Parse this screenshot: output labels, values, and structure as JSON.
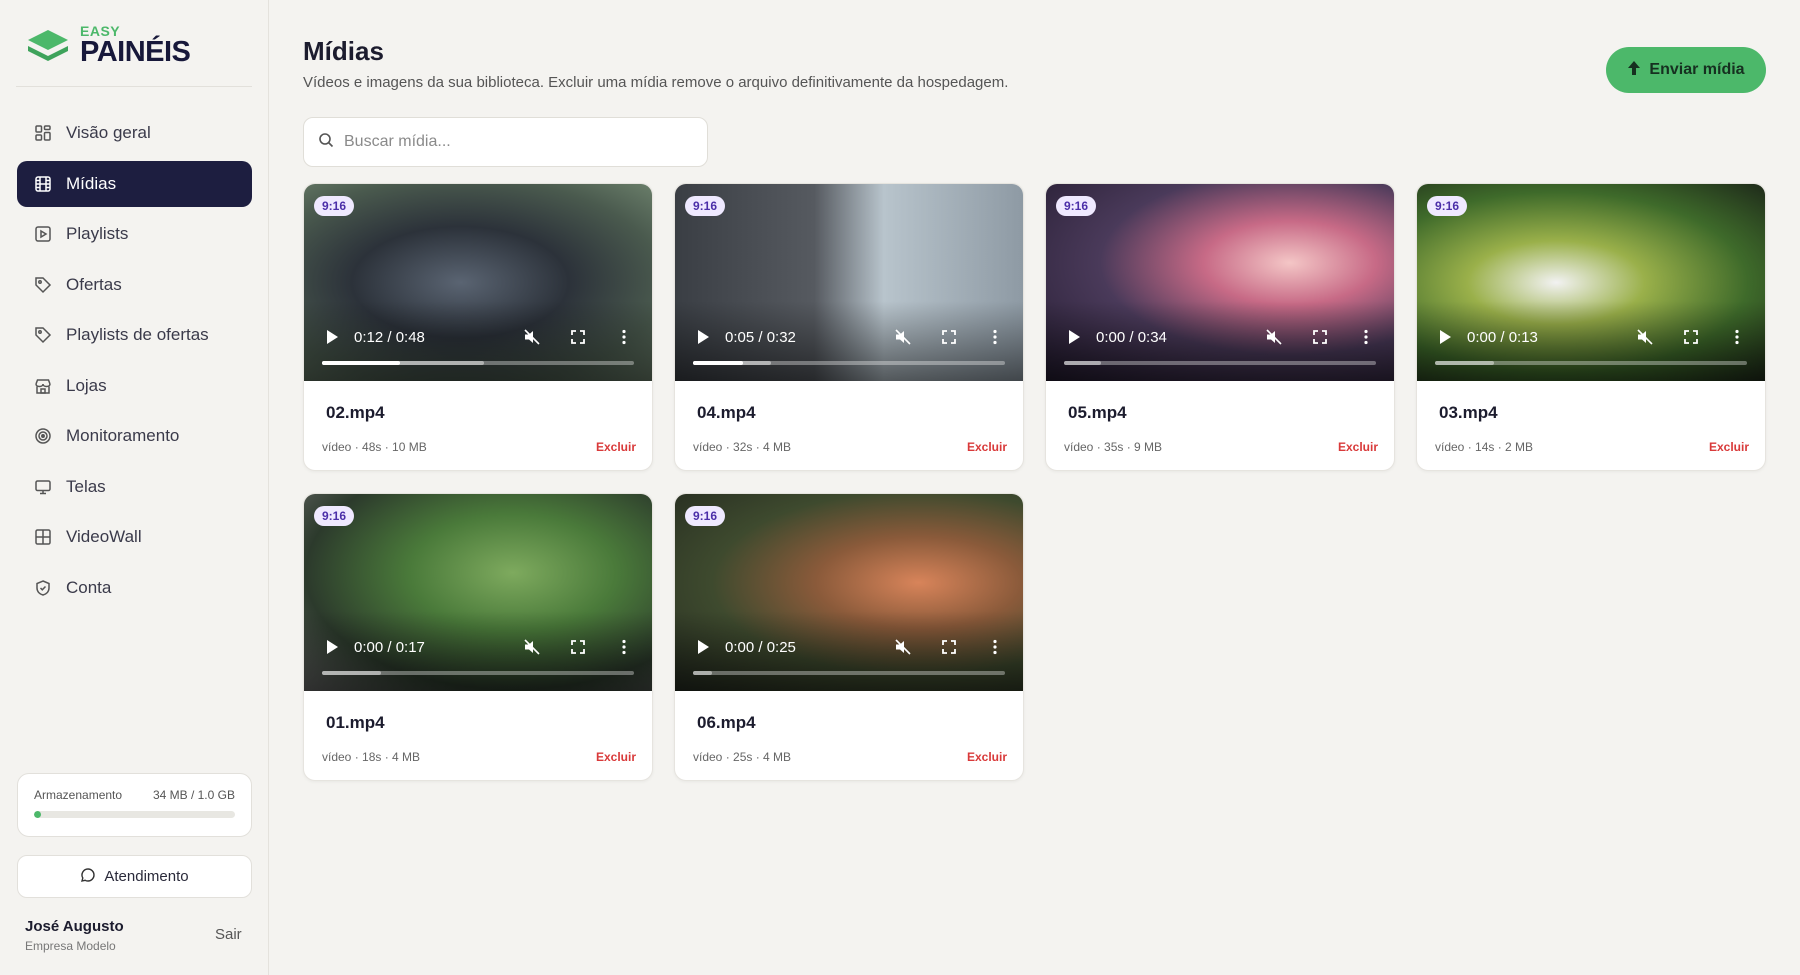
{
  "brand": {
    "line1": "EASY",
    "line2": "PAINÉIS"
  },
  "sidebar": {
    "items": [
      {
        "label": "Visão geral",
        "icon": "grid-icon",
        "active": false
      },
      {
        "label": "Mídias",
        "icon": "film-icon",
        "active": true
      },
      {
        "label": "Playlists",
        "icon": "play-square-icon",
        "active": false
      },
      {
        "label": "Ofertas",
        "icon": "tag-icon",
        "active": false
      },
      {
        "label": "Playlists de ofertas",
        "icon": "tag-icon",
        "active": false
      },
      {
        "label": "Lojas",
        "icon": "store-icon",
        "active": false
      },
      {
        "label": "Monitoramento",
        "icon": "radar-icon",
        "active": false
      },
      {
        "label": "Telas",
        "icon": "monitor-icon",
        "active": false
      },
      {
        "label": "VideoWall",
        "icon": "grid-2x2-icon",
        "active": false
      },
      {
        "label": "Conta",
        "icon": "shield-icon",
        "active": false
      }
    ],
    "storage": {
      "label": "Armazenamento",
      "value": "34 MB / 1.0 GB",
      "fraction": 0.033
    },
    "support_label": "Atendimento",
    "user": {
      "name": "José Augusto",
      "company": "Empresa Modelo",
      "logout": "Sair"
    }
  },
  "main": {
    "title": "Mídias",
    "subtitle": "Vídeos e imagens da sua biblioteca. Excluir uma mídia remove o arquivo definitivamente da hospedagem.",
    "upload_label": "Enviar mídia",
    "search_placeholder": "Buscar mídia...",
    "delete_label": "Excluir",
    "media": [
      {
        "name": "02.mp4",
        "ratio": "9:16",
        "time": "0:12 / 0:48",
        "meta": "vídeo · 48s · 10 MB",
        "progress": 0.25,
        "buffered": 0.52
      },
      {
        "name": "04.mp4",
        "ratio": "9:16",
        "time": "0:05 / 0:32",
        "meta": "vídeo · 32s · 4 MB",
        "progress": 0.16,
        "buffered": 0.25
      },
      {
        "name": "05.mp4",
        "ratio": "9:16",
        "time": "0:00 / 0:34",
        "meta": "vídeo · 35s · 9 MB",
        "progress": 0.0,
        "buffered": 0.12
      },
      {
        "name": "03.mp4",
        "ratio": "9:16",
        "time": "0:00 / 0:13",
        "meta": "vídeo · 14s · 2 MB",
        "progress": 0.0,
        "buffered": 0.19
      },
      {
        "name": "01.mp4",
        "ratio": "9:16",
        "time": "0:00 / 0:17",
        "meta": "vídeo · 18s · 4 MB",
        "progress": 0.0,
        "buffered": 0.19
      },
      {
        "name": "06.mp4",
        "ratio": "9:16",
        "time": "0:00 / 0:25",
        "meta": "vídeo · 25s · 4 MB",
        "progress": 0.0,
        "buffered": 0.06
      }
    ]
  },
  "colors": {
    "accent": "#4cb86a",
    "nav_active": "#1d1e40",
    "danger": "#d93a3a",
    "badge_bg": "#efe9ff",
    "badge_text": "#4b2ea8"
  }
}
